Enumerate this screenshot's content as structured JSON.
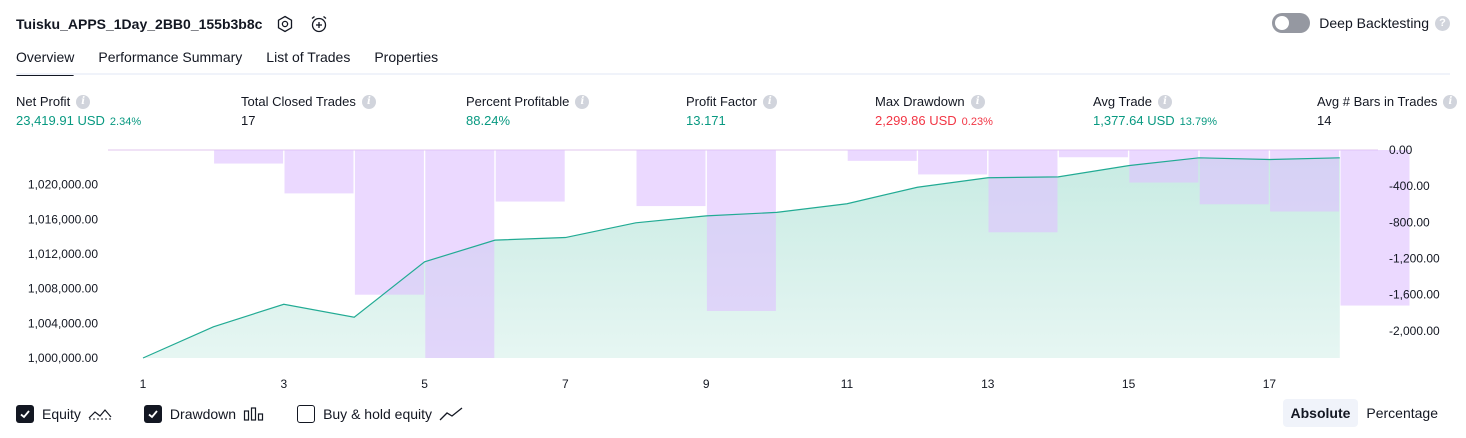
{
  "header": {
    "strategy_name": "Tuisku_APPS_1Day_2BB0_155b3b8c",
    "settings_icon": "settings-hexagon-icon",
    "alert_icon": "alarm-clock-plus-icon"
  },
  "deep_backtesting": {
    "label": "Deep Backtesting",
    "enabled": false
  },
  "tabs": [
    {
      "label": "Overview",
      "active": true
    },
    {
      "label": "Performance Summary",
      "active": false
    },
    {
      "label": "List of Trades",
      "active": false
    },
    {
      "label": "Properties",
      "active": false
    }
  ],
  "metrics": {
    "net_profit": {
      "title": "Net Profit",
      "value": "23,419.91 USD",
      "pct": "2.34%"
    },
    "total_closed_trades": {
      "title": "Total Closed Trades",
      "value": "17"
    },
    "percent_profitable": {
      "title": "Percent Profitable",
      "value": "88.24%"
    },
    "profit_factor": {
      "title": "Profit Factor",
      "value": "13.171"
    },
    "max_drawdown": {
      "title": "Max Drawdown",
      "value": "2,299.86 USD",
      "pct": "0.23%"
    },
    "avg_trade": {
      "title": "Avg Trade",
      "value": "1,377.64 USD",
      "pct": "13.79%"
    },
    "avg_bars": {
      "title": "Avg # Bars in Trades",
      "value": "14"
    }
  },
  "colors": {
    "positive": "#089981",
    "negative": "#f23645",
    "equity_line": "#22ab94",
    "equity_fill": "#c8ebe3",
    "drawdown_bar": "#dfc2ff",
    "overlap_bar": "#b0b6e2"
  },
  "chart_data": {
    "type": "line",
    "x": [
      1,
      2,
      3,
      4,
      5,
      6,
      7,
      8,
      9,
      10,
      11,
      12,
      13,
      14,
      15,
      16,
      17,
      18
    ],
    "x_tick_labels": [
      "1",
      "3",
      "5",
      "7",
      "9",
      "11",
      "13",
      "15",
      "17"
    ],
    "series": [
      {
        "axis": "left",
        "style": "area",
        "values": [
          1000000,
          1003600,
          1006200,
          1004700,
          1011100,
          1013600,
          1013900,
          1015600,
          1016400,
          1016800,
          1017800,
          1019700,
          1020800,
          1020900,
          1022200,
          1023100,
          1022900,
          1023100
        ]
      },
      {
        "axis": "right",
        "style": "bar",
        "values": [
          0,
          -150,
          -480,
          -1600,
          -2300,
          -570,
          0,
          -620,
          -1780,
          0,
          -120,
          -270,
          -910,
          -80,
          -360,
          -600,
          -680,
          -1720
        ]
      }
    ],
    "y_left": {
      "ylim": [
        1000000,
        1024000
      ],
      "ticks": [
        "1,000,000.00",
        "1,004,000.00",
        "1,008,000.00",
        "1,012,000.00",
        "1,016,000.00",
        "1,020,000.00"
      ]
    },
    "y_right": {
      "ylim": [
        -2300,
        0
      ],
      "ticks": [
        "0.00",
        "-400.00",
        "-800.00",
        "-1,200.00",
        "-1,600.00",
        "-2,000.00"
      ]
    }
  },
  "legend": {
    "equity": {
      "label": "Equity",
      "checked": true
    },
    "drawdown": {
      "label": "Drawdown",
      "checked": true
    },
    "buy_hold": {
      "label": "Buy & hold equity",
      "checked": false
    }
  },
  "view_mode": {
    "absolute": "Absolute",
    "percentage": "Percentage",
    "selected": "Absolute"
  }
}
